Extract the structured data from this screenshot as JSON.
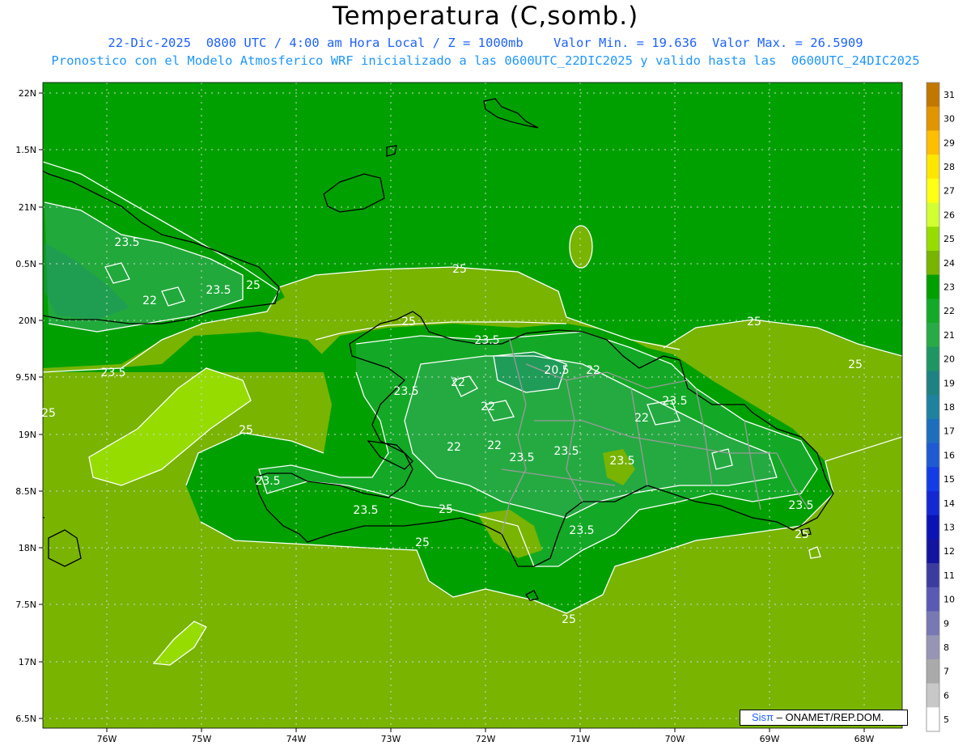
{
  "header": {
    "title": "Temperatura (C,somb.)",
    "line1": "22-Dic-2025  0800 UTC / 4:00 am Hora Local / Z = 1000mb    Valor Min. = 19.636  Valor Max. = 26.5909",
    "line2": "Pronostico con el Modelo Atmosferico WRF inicializado a las 0600UTC_22DIC2025 y valido hasta las  0600UTC_24DIC2025"
  },
  "axes": {
    "lat_labels": [
      "22N",
      "1.5N",
      "21N",
      "0.5N",
      "20N",
      "9.5N",
      "19N",
      "8.5N",
      "18N",
      "7.5N",
      "17N",
      "6.5N"
    ],
    "lon_labels": [
      "76W",
      "75W",
      "74W",
      "73W",
      "72W",
      "71W",
      "70W",
      "69W",
      "68W"
    ]
  },
  "colorbar": {
    "labels": [
      "31",
      "30",
      "29",
      "28",
      "27",
      "26",
      "25",
      "24",
      "23",
      "22",
      "21",
      "20",
      "19",
      "18",
      "17",
      "16",
      "15",
      "14",
      "13",
      "12",
      "11",
      "10",
      "9",
      "8",
      "7",
      "6",
      "5"
    ],
    "colors": [
      "#c07800",
      "#e09600",
      "#ffbe00",
      "#ffe600",
      "#ffff14",
      "#d2ff32",
      "#96dc00",
      "#78b400",
      "#00a000",
      "#14aa28",
      "#28aa46",
      "#1e9664",
      "#1e8282",
      "#1e82a0",
      "#1e6ebe",
      "#1e5ad2",
      "#143ce6",
      "#1428d2",
      "#0a14b4",
      "#1414a0",
      "#3c3ca0",
      "#5a5ab4",
      "#7878b4",
      "#9696b4",
      "#aaaaaa",
      "#c8c8c8",
      "#ffffff"
    ]
  },
  "contours": {
    "labels": [
      {
        "text": "23.5",
        "icon": "contour"
      },
      {
        "text": "23.5",
        "icon": "contour"
      },
      {
        "text": "22",
        "icon": "contour"
      },
      {
        "text": "25",
        "icon": "contour"
      },
      {
        "text": "23.5",
        "icon": "contour"
      },
      {
        "text": "25",
        "icon": "contour"
      },
      {
        "text": "25",
        "icon": "contour"
      },
      {
        "text": "25",
        "icon": "contour"
      },
      {
        "text": "23.5",
        "icon": "contour"
      },
      {
        "text": "20.5",
        "icon": "contour"
      },
      {
        "text": "22",
        "icon": "contour"
      },
      {
        "text": "25",
        "icon": "contour"
      },
      {
        "text": "25",
        "icon": "contour"
      },
      {
        "text": "22",
        "icon": "contour"
      },
      {
        "text": "23.5",
        "icon": "contour"
      },
      {
        "text": "23.5",
        "icon": "contour"
      },
      {
        "text": "22",
        "icon": "contour"
      },
      {
        "text": "25",
        "icon": "contour"
      },
      {
        "text": "22",
        "icon": "contour"
      },
      {
        "text": "22",
        "icon": "contour"
      },
      {
        "text": "22",
        "icon": "contour"
      },
      {
        "text": "23.5",
        "icon": "contour"
      },
      {
        "text": "23.5",
        "icon": "contour"
      },
      {
        "text": "23.5",
        "icon": "contour"
      },
      {
        "text": "23.5",
        "icon": "contour"
      },
      {
        "text": "25",
        "icon": "contour"
      },
      {
        "text": "23.5",
        "icon": "contour"
      },
      {
        "text": "23.5",
        "icon": "contour"
      },
      {
        "text": "25",
        "icon": "contour"
      },
      {
        "text": "25",
        "icon": "contour"
      },
      {
        "text": "23.5",
        "icon": "contour"
      },
      {
        "text": "25",
        "icon": "contour"
      }
    ]
  },
  "credit": {
    "sis": "Sisπ",
    "rest": "– ONAMET/REP.DOM."
  }
}
